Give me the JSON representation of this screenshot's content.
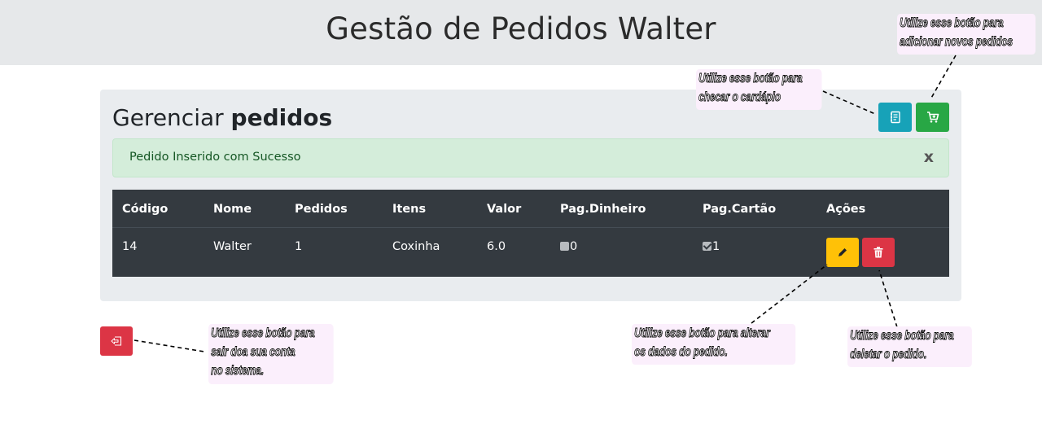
{
  "header": {
    "title": "Gestão de Pedidos Walter"
  },
  "panel": {
    "title_prefix": "Gerenciar ",
    "title_bold": "pedidos",
    "alert": {
      "text": "Pedido Inserido com Sucesso",
      "close": "x"
    }
  },
  "table": {
    "headers": [
      "Código",
      "Nome",
      "Pedidos",
      "Itens",
      "Valor",
      "Pag.Dinheiro",
      "Pag.Cartão",
      "Ações"
    ],
    "rows": [
      {
        "codigo": "14",
        "nome": "Walter",
        "pedidos": "1",
        "itens": "Coxinha",
        "valor": "6.0",
        "pag_dinheiro": "0",
        "pag_dinheiro_checked": false,
        "pag_cartao": "1",
        "pag_cartao_checked": true
      }
    ]
  },
  "buttons": {
    "menu": {
      "icon": "menu-book-icon",
      "color": "#17a2b8"
    },
    "add_order": {
      "icon": "cart-plus-icon",
      "color": "#28a745"
    },
    "edit": {
      "icon": "pencil-icon",
      "color": "#ffc107"
    },
    "delete": {
      "icon": "trash-icon",
      "color": "#dc3545"
    },
    "logout": {
      "icon": "logout-icon",
      "color": "#dc3545"
    }
  },
  "annotations": {
    "add": [
      "Utilize esse botão para",
      "adicionar novos pedidos"
    ],
    "menu": [
      "Utilize esse botão para",
      "checar  o cardápio"
    ],
    "logout": [
      "Utilize esse botão para",
      "sair doa sua conta",
      "no sistema."
    ],
    "edit": [
      "Utilize esse botão para alterar",
      "os dados do pedido."
    ],
    "delete": [
      "Utilize esse botão para",
      "deletar o pedido."
    ]
  },
  "colors": {
    "header_bg": "#e6e8ea",
    "panel_bg": "#e9ecef",
    "table_bg": "#343a40",
    "alert_bg": "#d4edda",
    "alert_text": "#155724"
  }
}
